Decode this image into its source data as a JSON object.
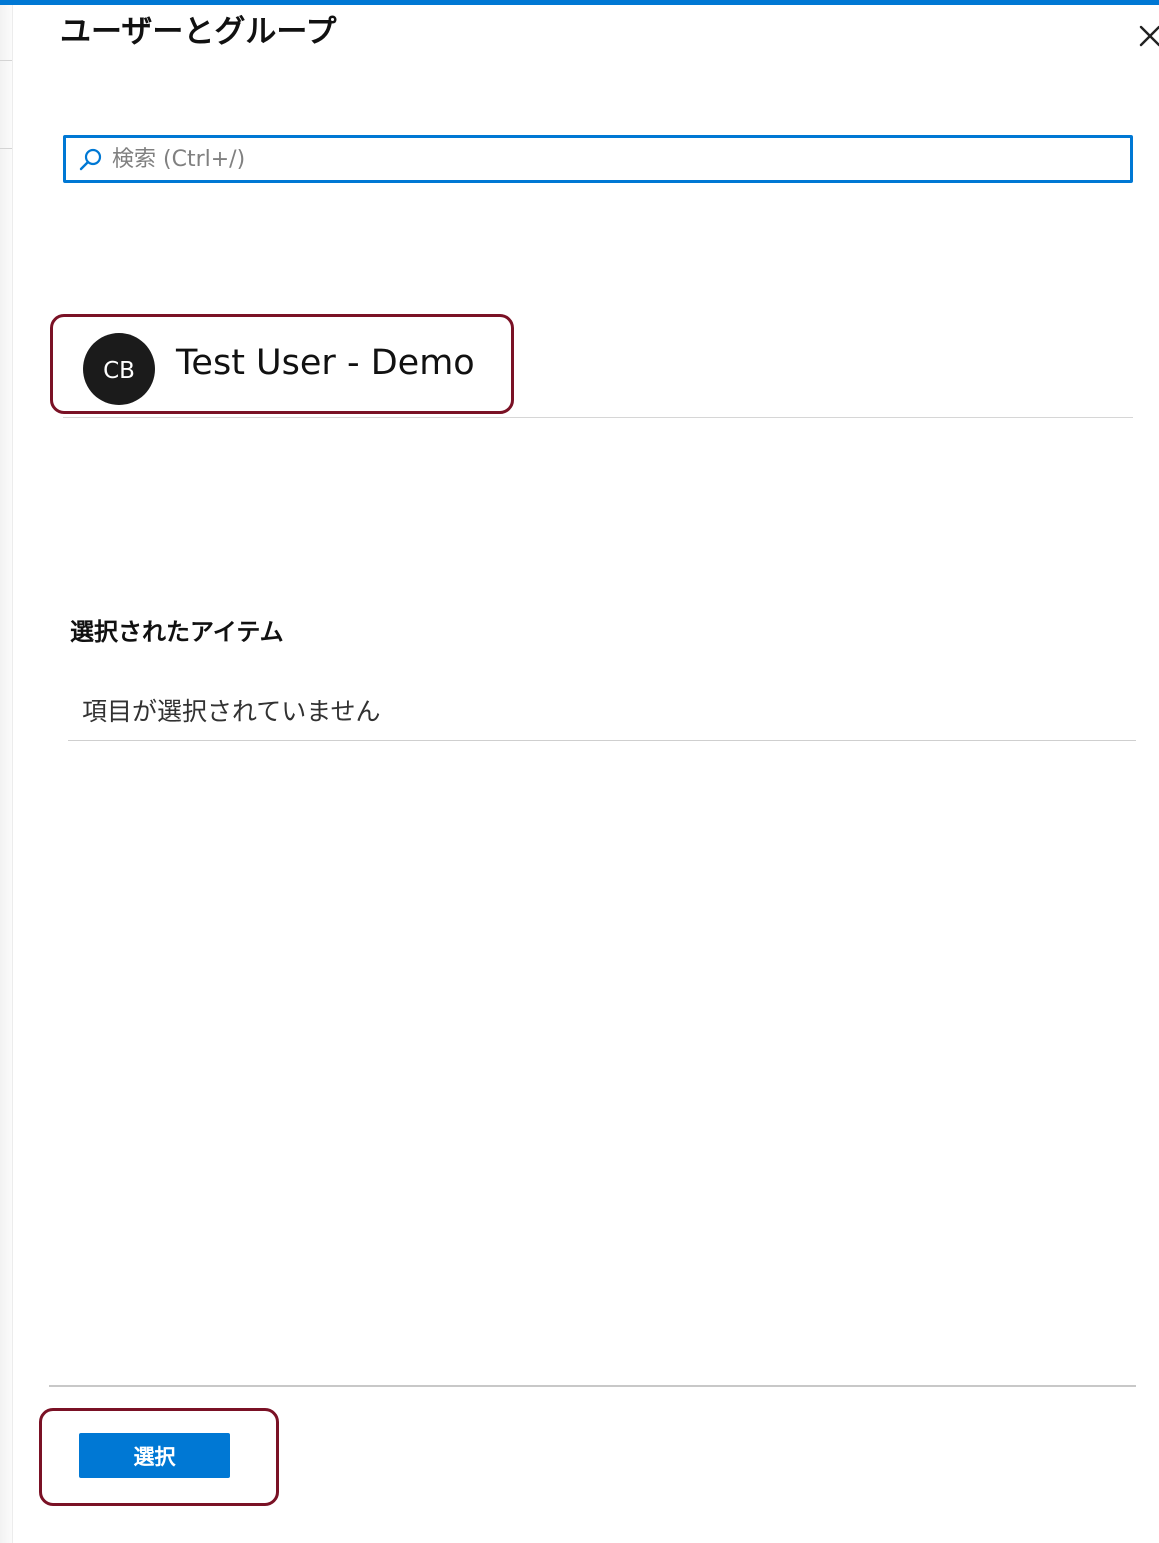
{
  "panel": {
    "title": "ユーザーとグループ"
  },
  "search": {
    "placeholder": "検索 (Ctrl+/)",
    "value": ""
  },
  "results": [
    {
      "initials": "CB",
      "name": "Test User - Demo"
    }
  ],
  "selected": {
    "heading": "選択されたアイテム",
    "empty_text": "項目が選択されていません"
  },
  "footer": {
    "select_label": "選択"
  },
  "icons": {
    "search": "search-icon",
    "close": "close-icon"
  },
  "colors": {
    "accent": "#0078d4",
    "highlight": "#7a1125",
    "avatar_bg": "#1b1b1b"
  }
}
